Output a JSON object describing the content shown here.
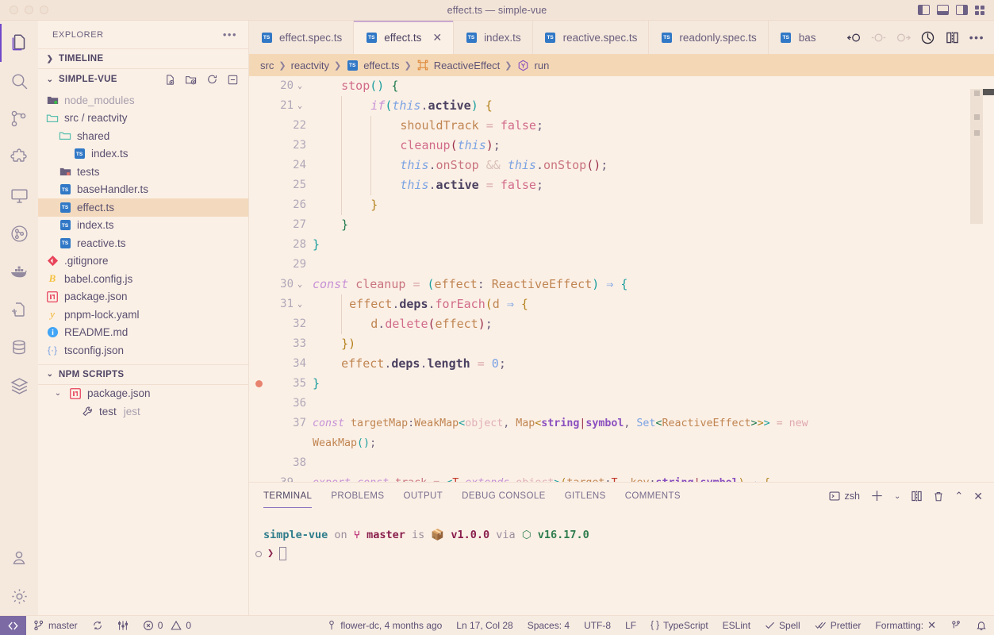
{
  "window": {
    "title": "effect.ts — simple-vue",
    "traffic_lights": [
      "close",
      "minimize",
      "zoom"
    ],
    "layout_actions": [
      "toggle-primary-sidebar",
      "toggle-panel",
      "toggle-secondary-sidebar",
      "customize-layout"
    ]
  },
  "activitybar": {
    "items": [
      {
        "name": "explorer",
        "icon": "files-icon",
        "active": true
      },
      {
        "name": "search",
        "icon": "search-icon",
        "active": false
      },
      {
        "name": "source-control",
        "icon": "source-control-icon",
        "active": false
      },
      {
        "name": "extensions",
        "icon": "extensions-icon",
        "active": false
      },
      {
        "name": "remote-explorer",
        "icon": "remote-monitor-icon",
        "active": false
      },
      {
        "name": "gitlens",
        "icon": "gitlens-icon",
        "active": false
      },
      {
        "name": "docker",
        "icon": "docker-whale-icon",
        "active": false
      },
      {
        "name": "new-file",
        "icon": "new-file-icon",
        "active": false
      },
      {
        "name": "database",
        "icon": "database-icon",
        "active": false
      },
      {
        "name": "layers",
        "icon": "layers-icon",
        "active": false
      }
    ],
    "bottom_items": [
      {
        "name": "accounts",
        "icon": "account-icon"
      },
      {
        "name": "manage-settings",
        "icon": "gear-icon"
      }
    ]
  },
  "sidebar": {
    "header": {
      "label": "EXPLORER",
      "more_icon": "ellipsis-icon"
    },
    "timeline": {
      "label": "TIMELINE",
      "expanded": false,
      "chevron": "chevron-right-icon"
    },
    "project": {
      "label": "SIMPLE-VUE",
      "expanded": true,
      "chevron": "chevron-down-icon",
      "actions": [
        "new-file-icon",
        "new-folder-icon",
        "refresh-icon",
        "collapse-all-icon"
      ]
    },
    "files": [
      {
        "name": "node_modules",
        "type": "folder-collapsed",
        "icon": "folder-node-icon",
        "indent": 0,
        "dim": true
      },
      {
        "name": "src / reactvity",
        "type": "folder-open",
        "icon": "folder-open-icon",
        "indent": 0,
        "dim": false
      },
      {
        "name": "shared",
        "type": "folder-open",
        "icon": "folder-open-icon",
        "indent": 1,
        "dim": false
      },
      {
        "name": "index.ts",
        "type": "file",
        "icon": "typescript-icon",
        "indent": 2,
        "dim": false
      },
      {
        "name": "tests",
        "type": "folder-collapsed",
        "icon": "folder-test-icon",
        "indent": 1,
        "dim": false
      },
      {
        "name": "baseHandler.ts",
        "type": "file",
        "icon": "typescript-icon",
        "indent": 1,
        "dim": false
      },
      {
        "name": "effect.ts",
        "type": "file",
        "icon": "typescript-icon",
        "indent": 1,
        "dim": false,
        "selected": true
      },
      {
        "name": "index.ts",
        "type": "file",
        "icon": "typescript-icon",
        "indent": 1,
        "dim": false
      },
      {
        "name": "reactive.ts",
        "type": "file",
        "icon": "typescript-icon",
        "indent": 1,
        "dim": false
      },
      {
        "name": ".gitignore",
        "type": "file",
        "icon": "git-icon",
        "indent": 0,
        "dim": false
      },
      {
        "name": "babel.config.js",
        "type": "file",
        "icon": "babel-icon",
        "indent": 0,
        "dim": false
      },
      {
        "name": "package.json",
        "type": "file",
        "icon": "npm-icon",
        "indent": 0,
        "dim": false
      },
      {
        "name": "pnpm-lock.yaml",
        "type": "file",
        "icon": "yaml-icon",
        "indent": 0,
        "dim": false
      },
      {
        "name": "README.md",
        "type": "file",
        "icon": "readme-icon",
        "indent": 0,
        "dim": false
      },
      {
        "name": "tsconfig.json",
        "type": "file",
        "icon": "tsconfig-icon",
        "indent": 0,
        "dim": false
      }
    ],
    "npm_scripts": {
      "label": "NPM SCRIPTS",
      "expanded": true,
      "chevron": "chevron-down-icon",
      "items": [
        {
          "name": "package.json",
          "icon": "npm-icon",
          "indent": 1,
          "chevron": "chevron-down-icon"
        },
        {
          "name": "test",
          "detail": "jest",
          "icon": "wrench-icon",
          "indent": 2
        }
      ]
    }
  },
  "tabs": {
    "items": [
      {
        "label": "effect.spec.ts",
        "icon": "typescript-icon",
        "active": false,
        "closable": false
      },
      {
        "label": "effect.ts",
        "icon": "typescript-icon",
        "active": true,
        "closable": true,
        "close_icon": "close-icon"
      },
      {
        "label": "index.ts",
        "icon": "typescript-icon",
        "active": false,
        "closable": false
      },
      {
        "label": "reactive.spec.ts",
        "icon": "typescript-icon",
        "active": false,
        "closable": false
      },
      {
        "label": "readonly.spec.ts",
        "icon": "typescript-icon",
        "active": false,
        "closable": false
      },
      {
        "label": "bas",
        "icon": "typescript-icon",
        "active": false,
        "closable": false
      }
    ],
    "actions": [
      "step-back-icon",
      "step-over-icon",
      "step-into-icon",
      "run-icon",
      "split-editor-icon",
      "more-actions-icon"
    ]
  },
  "breadcrumb": {
    "items": [
      {
        "label": "src",
        "icon": null
      },
      {
        "label": "reactvity",
        "icon": null
      },
      {
        "label": "effect.ts",
        "icon": "typescript-icon"
      },
      {
        "label": "ReactiveEffect",
        "icon": "class-icon"
      },
      {
        "label": "run",
        "icon": "method-icon"
      }
    ],
    "separator": "›"
  },
  "editor": {
    "first_visible_line": 20,
    "breakpoint_line": 35,
    "folded_lines": [
      20,
      21,
      30,
      31,
      39
    ],
    "lines": [
      {
        "n": 20,
        "text": "    stop() {"
      },
      {
        "n": 21,
        "text": "        if(this.active) {"
      },
      {
        "n": 22,
        "text": "            shouldTrack = false;"
      },
      {
        "n": 23,
        "text": "            cleanup(this);"
      },
      {
        "n": 24,
        "text": "            this.onStop && this.onStop();"
      },
      {
        "n": 25,
        "text": "            this.active = false;"
      },
      {
        "n": 26,
        "text": "        }"
      },
      {
        "n": 27,
        "text": "    }"
      },
      {
        "n": 28,
        "text": "}"
      },
      {
        "n": 29,
        "text": ""
      },
      {
        "n": 30,
        "text": "const cleanup = (effect: ReactiveEffect) => {"
      },
      {
        "n": 31,
        "text": "    effect.deps.forEach(d => {"
      },
      {
        "n": 32,
        "text": "        d.delete(effect);"
      },
      {
        "n": 33,
        "text": "    })"
      },
      {
        "n": 34,
        "text": "    effect.deps.length = 0;"
      },
      {
        "n": 35,
        "text": "}"
      },
      {
        "n": 36,
        "text": ""
      },
      {
        "n": 37,
        "text": "const targetMap:WeakMap<object, Map<string|symbol, Set<ReactiveEffect>>> = new WeakMap();"
      },
      {
        "n": 38,
        "text": ""
      },
      {
        "n": 39,
        "text": "export const track = <T extends object>(target:T, key:string|symbol) => {"
      }
    ]
  },
  "panel": {
    "tabs": [
      {
        "label": "TERMINAL",
        "active": true
      },
      {
        "label": "PROBLEMS",
        "active": false
      },
      {
        "label": "OUTPUT",
        "active": false
      },
      {
        "label": "DEBUG CONSOLE",
        "active": false
      },
      {
        "label": "GITLENS",
        "active": false
      },
      {
        "label": "COMMENTS",
        "active": false
      }
    ],
    "shell_label": "zsh",
    "actions": [
      "new-terminal-icon",
      "terminal-profile-chevron-icon",
      "split-terminal-icon",
      "kill-terminal-icon",
      "maximize-panel-icon",
      "close-panel-icon"
    ],
    "terminal": {
      "project": "simple-vue",
      "on": "on",
      "branch": "master",
      "is": "is",
      "version": "v1.0.0",
      "via": "via",
      "node_version": "v16.17.0",
      "prompt_symbol": "❯",
      "branch_icon": "git-branch-icon",
      "package_icon": "package-icon",
      "node_icon": "node-icon"
    }
  },
  "statusbar": {
    "remote_icon": "remote-window-icon",
    "left": [
      {
        "label": "master",
        "icon": "source-control-branch-icon"
      },
      {
        "label": "",
        "icon": "sync-icon"
      },
      {
        "label": "",
        "icon": "git-graph-icon"
      },
      {
        "label": "0",
        "icon": "error-icon"
      },
      {
        "label": "0",
        "icon": "warning-icon"
      }
    ],
    "right": [
      {
        "label": "flower-dc, 4 months ago",
        "icon": "gitlens-blame-icon"
      },
      {
        "label": "Ln 17, Col 28",
        "icon": null
      },
      {
        "label": "Spaces: 4",
        "icon": null
      },
      {
        "label": "UTF-8",
        "icon": null
      },
      {
        "label": "LF",
        "icon": null
      },
      {
        "label": "TypeScript",
        "icon": "braces-icon"
      },
      {
        "label": "ESLint",
        "icon": null
      },
      {
        "label": "Spell",
        "icon": "check-icon"
      },
      {
        "label": "Prettier",
        "icon": "double-check-icon"
      },
      {
        "label": "Formatting:",
        "icon": "close-icon"
      },
      {
        "label": "",
        "icon": "remote-account-icon"
      },
      {
        "label": "",
        "icon": "bell-icon"
      }
    ]
  },
  "colors": {
    "background": "#fbf0e6",
    "titlebar": "#f3e4d8",
    "breadcrumb": "#f4d8b6",
    "selection": "#f3d9bd",
    "accent": "#6f47c9",
    "statusbar_remote": "#7b6aa3",
    "breakpoint": "#e8836f"
  }
}
